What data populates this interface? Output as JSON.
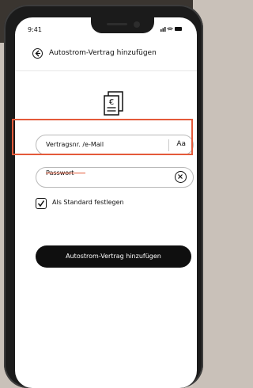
{
  "status_bar": {
    "time": "9:41",
    "icons": "▐▐ ◠ ▬"
  },
  "header": {
    "title": "Autostrom-Vertrag hinzufügen"
  },
  "form": {
    "login_placeholder": "Vertragsnr. /e-Mail",
    "login_toggle_label": "Aa",
    "password_placeholder": "Passwort",
    "checkbox_label": "Als Standard festlegen",
    "checkbox_checked": true,
    "submit_label": "Autostrom-Vertrag hinzufügen"
  },
  "icons": {
    "back": "back-arrow-icon",
    "document": "euro-document-icon",
    "clear": "clear-icon",
    "check": "checkmark-icon"
  },
  "colors": {
    "highlight": "#e45a3a",
    "primary_button": "#0f0f0f"
  }
}
